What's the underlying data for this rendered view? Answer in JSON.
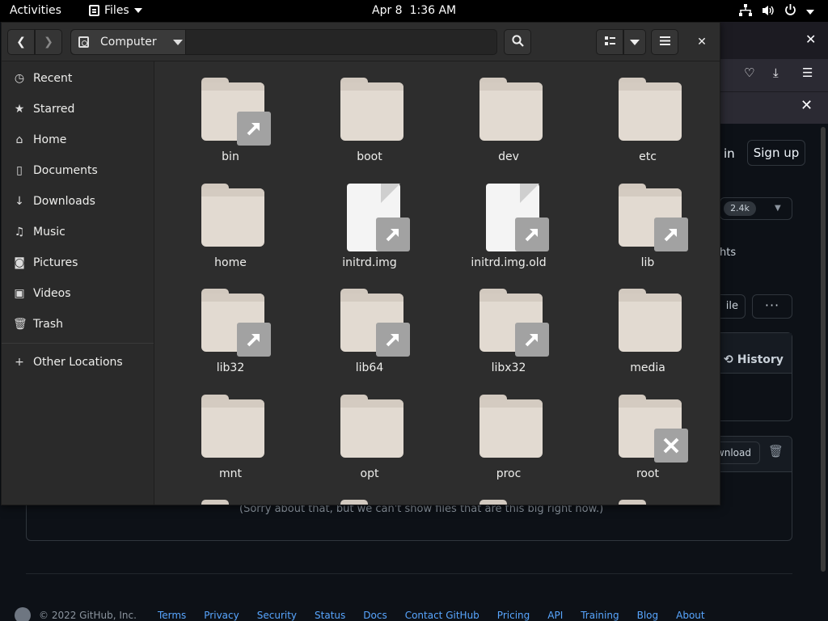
{
  "topbar": {
    "activities": "Activities",
    "app_name": "Files",
    "date": "Apr 8",
    "time": "1:36 AM",
    "icons": [
      "network-icon",
      "volume-icon",
      "power-icon"
    ]
  },
  "browser": {
    "signin_label": "in",
    "signup_label": "Sign up",
    "star_count": "2.4k",
    "insights_label": "hts",
    "add_file_label": "ile",
    "history_label": "History",
    "download_label": "wnload",
    "big_file_message": "(Sorry about that, but we can't show files that are this big right now.)",
    "footer": {
      "copyright": "© 2022 GitHub, Inc.",
      "links": [
        "Terms",
        "Privacy",
        "Security",
        "Status",
        "Docs",
        "Contact GitHub",
        "Pricing",
        "API",
        "Training",
        "Blog",
        "About"
      ]
    }
  },
  "files": {
    "path_current": "Computer",
    "sidebar": [
      {
        "label": "Recent",
        "icon": "clock-icon"
      },
      {
        "label": "Starred",
        "icon": "star-icon"
      },
      {
        "label": "Home",
        "icon": "home-icon"
      },
      {
        "label": "Documents",
        "icon": "document-icon"
      },
      {
        "label": "Downloads",
        "icon": "download-icon"
      },
      {
        "label": "Music",
        "icon": "music-icon"
      },
      {
        "label": "Pictures",
        "icon": "camera-icon"
      },
      {
        "label": "Videos",
        "icon": "video-icon"
      },
      {
        "label": "Trash",
        "icon": "trash-icon"
      },
      {
        "label": "Other Locations",
        "icon": "plus-icon"
      }
    ],
    "items": [
      {
        "name": "bin",
        "type": "folder",
        "emblem": "link"
      },
      {
        "name": "boot",
        "type": "folder",
        "emblem": ""
      },
      {
        "name": "dev",
        "type": "folder",
        "emblem": ""
      },
      {
        "name": "etc",
        "type": "folder",
        "emblem": ""
      },
      {
        "name": "home",
        "type": "folder",
        "emblem": ""
      },
      {
        "name": "initrd.img",
        "type": "file",
        "emblem": "link"
      },
      {
        "name": "initrd.img.old",
        "type": "file",
        "emblem": "link"
      },
      {
        "name": "lib",
        "type": "folder",
        "emblem": "link"
      },
      {
        "name": "lib32",
        "type": "folder",
        "emblem": "link"
      },
      {
        "name": "lib64",
        "type": "folder",
        "emblem": "link"
      },
      {
        "name": "libx32",
        "type": "folder",
        "emblem": "link"
      },
      {
        "name": "media",
        "type": "folder",
        "emblem": ""
      },
      {
        "name": "mnt",
        "type": "folder",
        "emblem": ""
      },
      {
        "name": "opt",
        "type": "folder",
        "emblem": ""
      },
      {
        "name": "proc",
        "type": "folder",
        "emblem": ""
      },
      {
        "name": "root",
        "type": "folder",
        "emblem": "locked"
      },
      {
        "name": "",
        "type": "folder",
        "emblem": ""
      },
      {
        "name": "",
        "type": "folder",
        "emblem": ""
      },
      {
        "name": "",
        "type": "folder",
        "emblem": ""
      },
      {
        "name": "",
        "type": "folder",
        "emblem": ""
      }
    ]
  }
}
